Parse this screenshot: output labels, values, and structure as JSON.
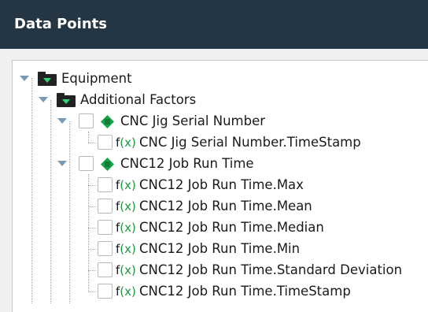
{
  "header": {
    "title": "Data Points"
  },
  "tree": {
    "root": {
      "label": "Equipment",
      "icon": "folder-icon"
    },
    "group": {
      "label": "Additional Factors",
      "icon": "folder-icon"
    },
    "factors": [
      {
        "label": "CNC Jig Serial Number",
        "icon": "green-diamond-icon",
        "checked": false,
        "children": [
          {
            "label": "CNC Jig Serial Number.TimeStamp",
            "icon": "function-icon",
            "checked": false
          }
        ]
      },
      {
        "label": "CNC12 Job Run Time",
        "icon": "green-diamond-icon",
        "checked": false,
        "children": [
          {
            "label": "CNC12 Job Run Time.Max",
            "icon": "function-icon",
            "checked": false
          },
          {
            "label": "CNC12 Job Run Time.Mean",
            "icon": "function-icon",
            "checked": false
          },
          {
            "label": "CNC12 Job Run Time.Median",
            "icon": "function-icon",
            "checked": false
          },
          {
            "label": "CNC12 Job Run Time.Min",
            "icon": "function-icon",
            "checked": false
          },
          {
            "label": "CNC12 Job Run Time.Standard Deviation",
            "icon": "function-icon",
            "checked": false
          },
          {
            "label": "CNC12 Job Run Time.TimeStamp",
            "icon": "function-icon",
            "checked": false
          }
        ]
      }
    ]
  },
  "icons": {
    "function_prefix": "f",
    "function_var": "(x)"
  },
  "colors": {
    "header_bg": "#243544",
    "accent_green": "#2fd67a",
    "caret_blue": "#7a9ab4"
  }
}
